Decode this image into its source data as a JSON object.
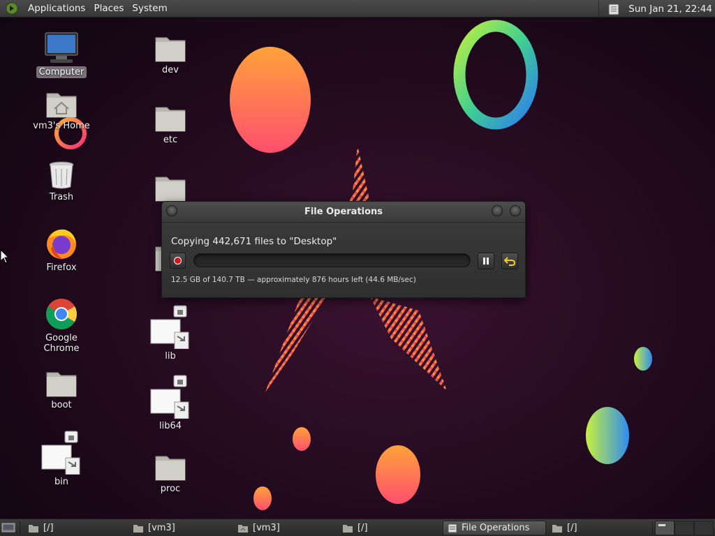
{
  "top_panel": {
    "menus": [
      "Applications",
      "Places",
      "System"
    ],
    "clock": "Sun Jan 21, 22:44"
  },
  "desktop_icons": {
    "computer": "Computer",
    "home": "vm3's Home",
    "trash": "Trash",
    "firefox": "Firefox",
    "chrome": "Google Chrome",
    "boot": "boot",
    "bin": "bin",
    "dev": "dev",
    "etc": "etc",
    "lib": "lib",
    "lib64": "lib64",
    "proc": "proc"
  },
  "dialog": {
    "title": "File Operations",
    "operation": "Copying 442,671 files to \"Desktop\"",
    "status": "12.5 GB of 140.7 TB — approximately 876 hours left (44.6 MB/sec)",
    "progress_fraction": 0.0001
  },
  "taskbar": {
    "tasks": [
      "[/]",
      "[vm3]",
      "[vm3]",
      "[/]",
      "File Operations",
      "[/]"
    ]
  },
  "colors": {
    "accent_red": "#d01818",
    "undo_yellow": "#f0d020"
  }
}
